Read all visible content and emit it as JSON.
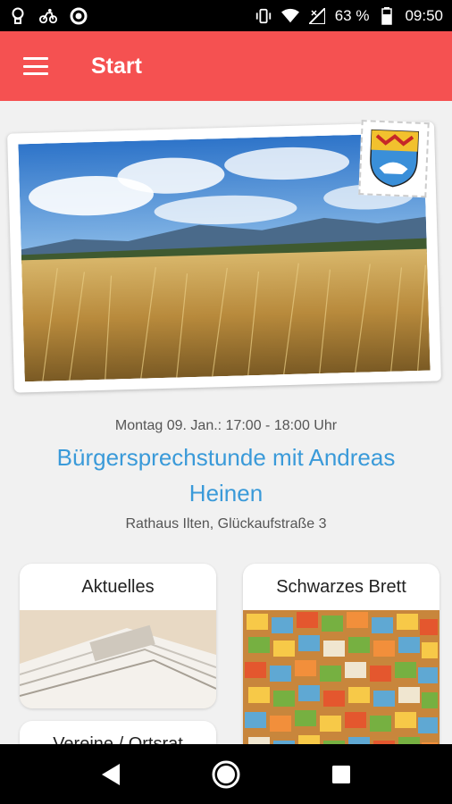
{
  "status_bar": {
    "battery_percent": "63 %",
    "time": "09:50",
    "icons": [
      "bulb-icon",
      "bike-icon",
      "circle-icon",
      "vibrate-icon",
      "wifi-icon",
      "signal-icon",
      "battery-icon"
    ]
  },
  "app_bar": {
    "title": "Start",
    "menu_icon": "hamburger-icon"
  },
  "event": {
    "date": "Montag 09. Jan.: 17:00 - 18:00 Uhr",
    "title": "Bürgersprechstunde mit Andreas Heinen",
    "location": "Rathaus Ilten, Glückaufstraße 3"
  },
  "tiles": {
    "aktuelles": "Aktuelles",
    "schwarzes_brett": "Schwarzes Brett",
    "vereine": "Vereine / Ortsrat"
  },
  "nav_bar": {
    "back_icon": "back-triangle-icon",
    "home_icon": "home-circle-icon",
    "recents_icon": "recents-square-icon"
  },
  "colors": {
    "accent": "#f55151",
    "event_title": "#3a9ad9",
    "background": "#f1f1f1"
  }
}
